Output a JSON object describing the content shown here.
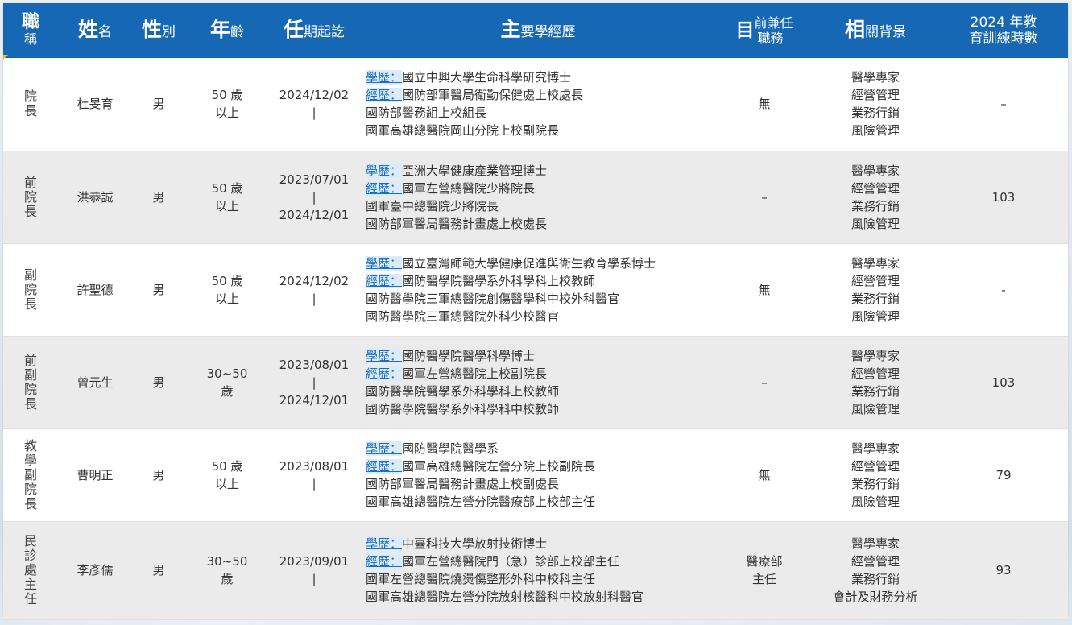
{
  "header": {
    "title_big": "職",
    "title_small": "稱",
    "name_big": "姓",
    "name_small": "名",
    "gender_big": "性",
    "gender_small": "別",
    "age_big": "年",
    "age_small": "齡",
    "term_big": "任",
    "term_small": "期起訖",
    "edu_big": "主",
    "edu_small": "要學經歷",
    "concurrent_big": "目",
    "concurrent_small_1": "前兼任",
    "concurrent_small_2": "職務",
    "background_big": "相",
    "background_small": "關背景",
    "hours_line1": "2024 年教",
    "hours_line2": "育訓練時數"
  },
  "edu_tag": "學歷：",
  "exp_tag": "經歷：",
  "rows": [
    {
      "title": [
        "院",
        "長"
      ],
      "name": "杜旻育",
      "gender": "男",
      "age": [
        "50 歲",
        "以上"
      ],
      "term": [
        "2024/12/02",
        "|"
      ],
      "edu": "國立中興大學生命科學研究博士",
      "exp": "國防部軍醫局衛勤保健處上校處長",
      "exp_more": [
        "國防部醫務組上校組長",
        "國軍高雄總醫院岡山分院上校副院長"
      ],
      "concurrent": [
        "無"
      ],
      "background": [
        "醫學專家",
        "經營管理",
        "業務行銷",
        "風險管理"
      ],
      "hours": "–"
    },
    {
      "title": [
        "前",
        "院",
        "長"
      ],
      "name": "洪恭誠",
      "gender": "男",
      "age": [
        "50 歲",
        "以上"
      ],
      "term": [
        "2023/07/01",
        "|",
        "2024/12/01"
      ],
      "edu": "亞洲大學健康產業管理博士",
      "exp": "國軍左營總醫院少將院長",
      "exp_more": [
        "國軍臺中總醫院少將院長",
        "國防部軍醫局醫務計畫處上校處長"
      ],
      "concurrent": [
        "–"
      ],
      "background": [
        "醫學專家",
        "經營管理",
        "業務行銷",
        "風險管理"
      ],
      "hours": "103"
    },
    {
      "title": [
        "副",
        "院",
        "長"
      ],
      "name": "許聖德",
      "gender": "男",
      "age": [
        "50 歲",
        "以上"
      ],
      "term": [
        "2024/12/02",
        "|"
      ],
      "edu": "國立臺灣師範大學健康促進與衛生教育學系博士",
      "exp": "國防醫學院醫學系外科學科上校教師",
      "exp_more": [
        "國防醫學院三軍總醫院創傷醫學科中校外科醫官",
        "國防醫學院三軍總醫院外科少校醫官"
      ],
      "concurrent": [
        "無"
      ],
      "background": [
        "醫學專家",
        "經營管理",
        "業務行銷",
        "風險管理"
      ],
      "hours": "-"
    },
    {
      "title": [
        "前",
        "副",
        "院",
        "長"
      ],
      "name": "曾元生",
      "gender": "男",
      "age": [
        "30~50",
        "歲"
      ],
      "term": [
        "2023/08/01",
        "|",
        "2024/12/01"
      ],
      "edu": "國防醫學院醫學科學博士",
      "exp": "國軍左營總醫院上校副院長",
      "exp_more": [
        "國防醫學院醫學系外科學科上校教師",
        "國防醫學院醫學系外科學科中校教師"
      ],
      "concurrent": [
        "–"
      ],
      "background": [
        "醫學專家",
        "經營管理",
        "業務行銷",
        "風險管理"
      ],
      "hours": "103"
    },
    {
      "title": [
        "教",
        "學",
        "副",
        "院",
        "長"
      ],
      "name": "曹明正",
      "gender": "男",
      "age": [
        "50 歲",
        "以上"
      ],
      "term": [
        "2023/08/01",
        "|"
      ],
      "edu": "國防醫學院醫學系",
      "exp": "國軍高雄總醫院左營分院上校副院長",
      "exp_more": [
        "國防部軍醫局醫務計畫處上校副處長",
        "國軍高雄總醫院左營分院醫療部上校部主任"
      ],
      "concurrent": [
        "無"
      ],
      "background": [
        "醫學專家",
        "經營管理",
        "業務行銷",
        "風險管理"
      ],
      "hours": "79"
    },
    {
      "title": [
        "民",
        "診",
        "處",
        "主",
        "任"
      ],
      "name": "李彥儒",
      "gender": "男",
      "age": [
        "30~50",
        "歲"
      ],
      "term": [
        "2023/09/01",
        "|"
      ],
      "edu": "中臺科技大學放射技術博士",
      "exp": "國軍左營總醫院門（急）診部上校部主任",
      "exp_more": [
        "國軍左營總醫院燒燙傷整形外科中校科主任",
        "國軍高雄總醫院左營分院放射核醫科中校放射科醫官"
      ],
      "concurrent": [
        "醫療部",
        "主任"
      ],
      "background": [
        "醫學專家",
        "經營管理",
        "業務行銷",
        "會計及財務分析"
      ],
      "hours": "93"
    }
  ],
  "colors": {
    "header_bg": "#1768b4",
    "tag_color": "#1a6fc0",
    "row_alt": "#ebebeb",
    "accent_corner": "#f2c200"
  }
}
